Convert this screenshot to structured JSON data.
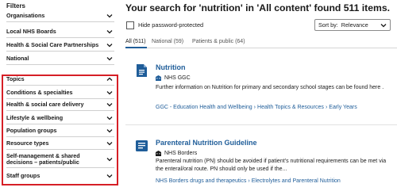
{
  "sidebar": {
    "title": "Filters",
    "items": [
      {
        "label": "Organisations"
      },
      {
        "label": "Local NHS Boards"
      },
      {
        "label": "Health & Social Care Partnerships"
      },
      {
        "label": "National"
      },
      {
        "label": "Topics"
      },
      {
        "label": "Conditions & specialties"
      },
      {
        "label": "Health & social care delivery"
      },
      {
        "label": "Lifestyle & wellbeing"
      },
      {
        "label": "Population groups"
      },
      {
        "label": "Resource types"
      },
      {
        "label": "Self-management & shared decisions – patients/public"
      },
      {
        "label": "Staff groups"
      }
    ],
    "highlight_color": "#d61f26"
  },
  "main": {
    "heading": "Your search for 'nutrition' in 'All content' found 511 items.",
    "hide_password_label": "Hide password-protected",
    "sort": {
      "label": "Sort by:",
      "value": "Relevance"
    },
    "tabs": [
      {
        "label": "All (511)"
      },
      {
        "label": "National (59)"
      },
      {
        "label": "Patients & public (64)"
      }
    ],
    "results": [
      {
        "title": "Nutrition",
        "org": "NHS GGC",
        "description": "Further information on Nutrition for primary and secondary school stages can be found here .",
        "breadcrumb": [
          "GGC - Education Health and Wellbeing",
          "Health Topics & Resources",
          "Early Years"
        ],
        "icon": "document-icon"
      },
      {
        "title": "Parenteral Nutrition Guideline",
        "org": "NHS Borders",
        "description": "Parenteral nutrition (PN) should be avoided if patient’s nutritional requirements can be met via the enteral/oral route. PN should only be used if the...",
        "breadcrumb": [
          "NHS Borders drugs and therapeutics",
          "Electrolytes and Parenteral Nutrition"
        ],
        "icon": "book-icon"
      }
    ]
  },
  "colors": {
    "link": "#1f5d99",
    "icon_blue": "#1f5d99",
    "highlight": "#d61f26"
  }
}
